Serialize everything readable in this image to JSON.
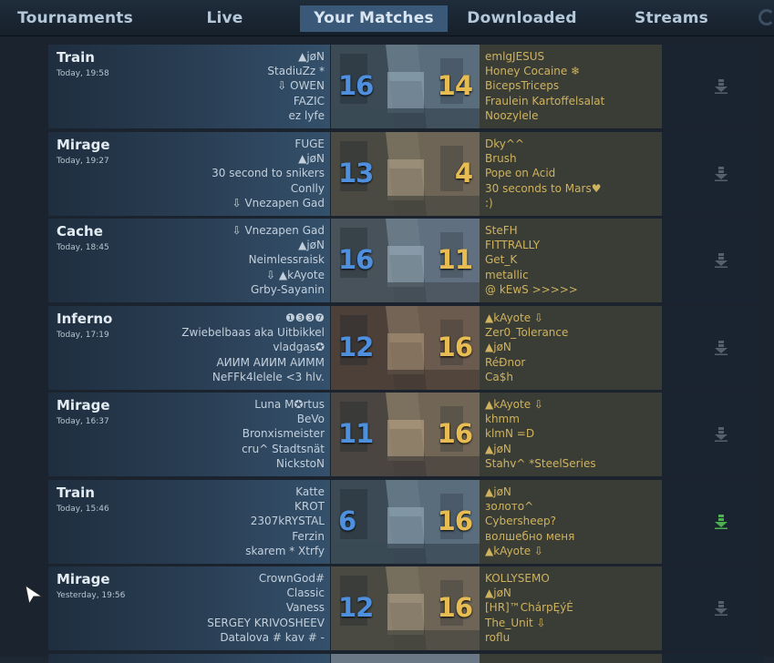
{
  "nav": {
    "tabs": [
      "Tournaments",
      "Live",
      "Your Matches",
      "Downloaded",
      "Streams"
    ],
    "active_index": 2
  },
  "colors": {
    "ct_score": "#4f90de",
    "t_score": "#e7bc52",
    "download_available": "#4caf50",
    "download_default": "#56606b"
  },
  "matches": [
    {
      "map": "Train",
      "time": "Today, 19:58",
      "score_left": "16",
      "score_right": "14",
      "left_players": [
        "▲jøN",
        "StadiuZz *",
        "⇩ OWEN",
        "FAZIC",
        "ez lyfe"
      ],
      "right_players": [
        "emlgJESUS",
        "Honey Cocaine ❄",
        "BicepsTriceps",
        "Fraulein Kartoffelsalat",
        "Noozylele"
      ],
      "download_state": "default"
    },
    {
      "map": "Mirage",
      "time": "Today, 19:27",
      "score_left": "13",
      "score_right": "4",
      "left_players": [
        "FUGE",
        "▲jøN",
        "30 second to snikers",
        "Conlly",
        "⇩ Vnezapen Gad"
      ],
      "right_players": [
        "Dky^^",
        "Brush",
        "Pope on Acid",
        "30 seconds to Mars♥",
        ":)"
      ],
      "download_state": "default"
    },
    {
      "map": "Cache",
      "time": "Today, 18:45",
      "score_left": "16",
      "score_right": "11",
      "left_players": [
        "⇩ Vnezapen Gad",
        "▲jøN",
        "Neimlessraisk",
        "⇩ ▲kAyote",
        "Grby-Sayanin"
      ],
      "right_players": [
        "SteFH",
        "FITTRALLY",
        "Get_K",
        "metallic",
        "@ kEwS >>>>>"
      ],
      "download_state": "default"
    },
    {
      "map": "Inferno",
      "time": "Today, 17:19",
      "score_left": "12",
      "score_right": "16",
      "left_players": [
        "❶❸❸❼",
        "Zwiebelbaas aka Uitbikkel",
        "vladgas✪",
        "АИИМ АИИМ АИММ",
        "NeFFk4lelele <3 hlv."
      ],
      "right_players": [
        "▲kAyote ⇩",
        "Zer0_Tolerance",
        "▲jøN",
        "RéÐnor",
        "Ca$h"
      ],
      "download_state": "default"
    },
    {
      "map": "Mirage",
      "time": "Today, 16:37",
      "score_left": "11",
      "score_right": "16",
      "left_players": [
        "Luna M✪rtus",
        "BeVo",
        "Bronxismeister",
        "cru^ Stadtsnät",
        "NickstoN"
      ],
      "right_players": [
        "▲kAyote ⇩",
        "khmm",
        "klmN =D",
        "▲jøN",
        "Stahv^ *SteelSeries"
      ],
      "download_state": "default"
    },
    {
      "map": "Train",
      "time": "Today, 15:46",
      "score_left": "6",
      "score_right": "16",
      "left_players": [
        "Katte",
        "KROT",
        "2307kRYSTAL",
        "Ferzin",
        "skarem * Xtrfy"
      ],
      "right_players": [
        "▲jøN",
        "золото^",
        "Cybersheep?",
        "волшебно меня",
        "▲kAyote ⇩"
      ],
      "download_state": "available"
    },
    {
      "map": "Mirage",
      "time": "Yesterday, 19:56",
      "score_left": "12",
      "score_right": "16",
      "left_players": [
        "CrownGod#",
        "Classic",
        "Vaness",
        "SERGEY KRIVOSHEEV",
        "Datalova # kav # -"
      ],
      "right_players": [
        "KOLLYSEMO",
        "▲jøN",
        "[HR]™ChárpĘýĖ",
        "The_Unit ⇩",
        "roflu"
      ],
      "download_state": "default"
    }
  ]
}
